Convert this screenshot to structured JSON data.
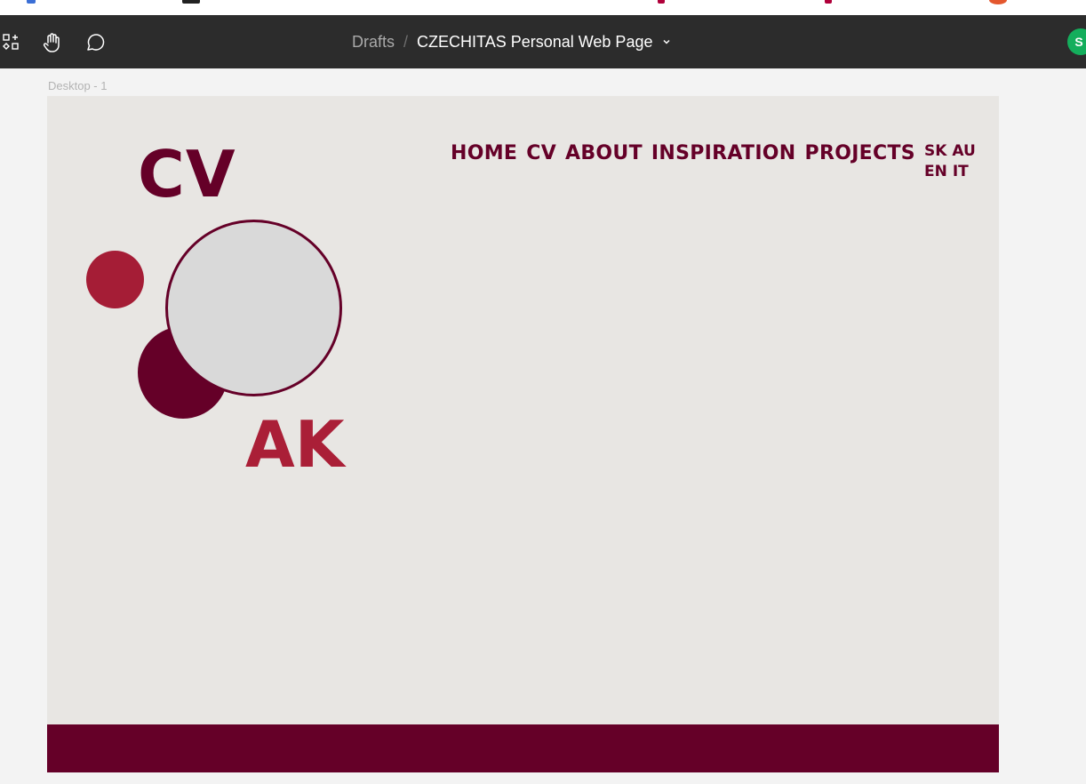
{
  "toolbar": {
    "breadcrumb": {
      "parent": "Drafts",
      "separator": "/",
      "file_name": "CZECHITAS Personal Web Page"
    },
    "avatar_initial": "S",
    "icons": [
      "shapes-icon",
      "hand-icon",
      "comment-icon",
      "chevron-down-icon"
    ]
  },
  "canvas": {
    "frame_label": "Desktop - 1"
  },
  "webpage": {
    "nav": [
      "HOME",
      "CV",
      "ABOUT",
      "INSPIRATION",
      "PROJECTS"
    ],
    "languages": [
      [
        "SK",
        "AU"
      ],
      [
        "EN",
        "IT"
      ]
    ],
    "heading_top": "CV",
    "heading_bottom": "AK"
  },
  "colors": {
    "maroon": "#650028",
    "crimson": "#a51d36",
    "circle_fill": "#d9d9d9",
    "frame_background": "#e8e6e3",
    "toolbar_background": "#2c2c2c",
    "avatar": "#14ae5c"
  }
}
